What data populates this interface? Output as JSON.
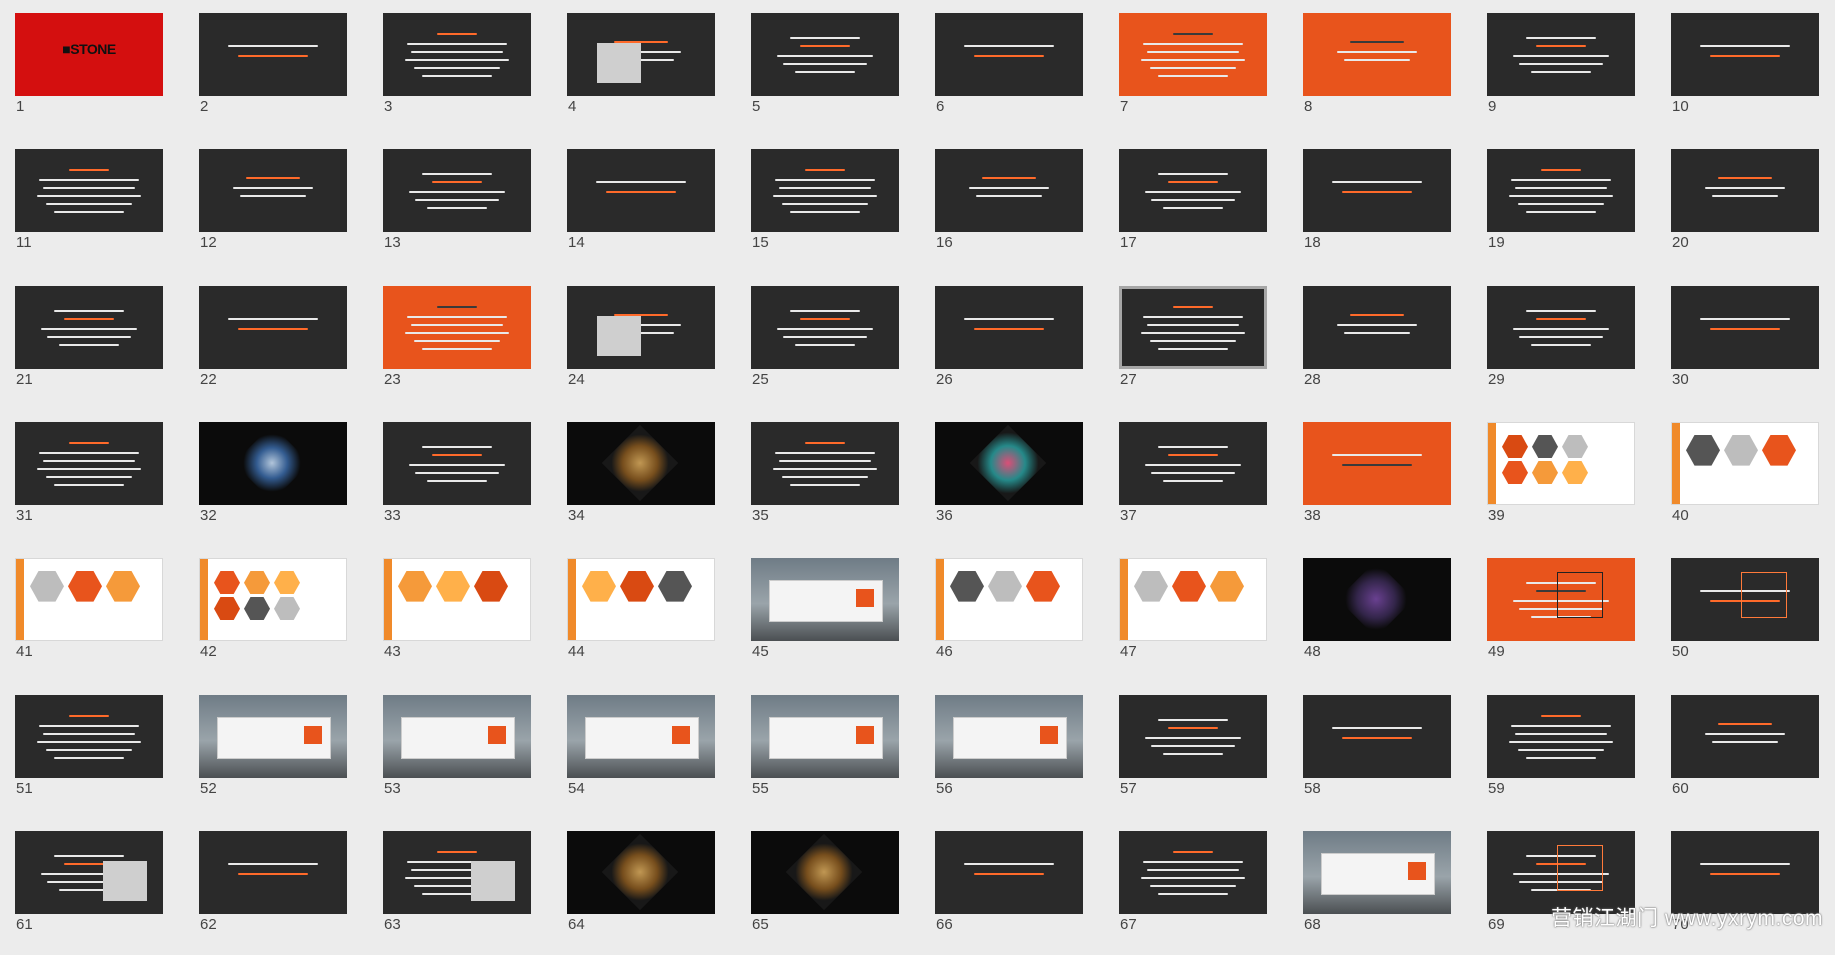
{
  "watermark": "营销江湖门 www.yxrym.com",
  "slide1_logo": "■STONE",
  "selected_slide": 27,
  "slides": [
    {
      "number": "1"
    },
    {
      "number": "2"
    },
    {
      "number": "3"
    },
    {
      "number": "4"
    },
    {
      "number": "5"
    },
    {
      "number": "6"
    },
    {
      "number": "7"
    },
    {
      "number": "8"
    },
    {
      "number": "9"
    },
    {
      "number": "10"
    },
    {
      "number": "11"
    },
    {
      "number": "12"
    },
    {
      "number": "13"
    },
    {
      "number": "14"
    },
    {
      "number": "15"
    },
    {
      "number": "16"
    },
    {
      "number": "17"
    },
    {
      "number": "18"
    },
    {
      "number": "19"
    },
    {
      "number": "20"
    },
    {
      "number": "21"
    },
    {
      "number": "22"
    },
    {
      "number": "23"
    },
    {
      "number": "24"
    },
    {
      "number": "25"
    },
    {
      "number": "26"
    },
    {
      "number": "27"
    },
    {
      "number": "28"
    },
    {
      "number": "29"
    },
    {
      "number": "30"
    },
    {
      "number": "31"
    },
    {
      "number": "32"
    },
    {
      "number": "33"
    },
    {
      "number": "34"
    },
    {
      "number": "35"
    },
    {
      "number": "36"
    },
    {
      "number": "37"
    },
    {
      "number": "38"
    },
    {
      "number": "39"
    },
    {
      "number": "40"
    },
    {
      "number": "41"
    },
    {
      "number": "42"
    },
    {
      "number": "43"
    },
    {
      "number": "44"
    },
    {
      "number": "45"
    },
    {
      "number": "46"
    },
    {
      "number": "47"
    },
    {
      "number": "48"
    },
    {
      "number": "49"
    },
    {
      "number": "50"
    },
    {
      "number": "51"
    },
    {
      "number": "52"
    },
    {
      "number": "53"
    },
    {
      "number": "54"
    },
    {
      "number": "55"
    },
    {
      "number": "56"
    },
    {
      "number": "57"
    },
    {
      "number": "58"
    },
    {
      "number": "59"
    },
    {
      "number": "60"
    },
    {
      "number": "61"
    },
    {
      "number": "62"
    },
    {
      "number": "63"
    },
    {
      "number": "64"
    },
    {
      "number": "65"
    },
    {
      "number": "66"
    },
    {
      "number": "67"
    },
    {
      "number": "68"
    },
    {
      "number": "69"
    },
    {
      "number": "70"
    }
  ],
  "theme_colors": {
    "dark": "#2a2a2a",
    "orange": "#e8541c",
    "red": "#d40f0f",
    "white": "#ffffff",
    "black": "#0b0b0b"
  },
  "slide_themes": [
    "red",
    "dark",
    "dark",
    "dark",
    "dark",
    "dark",
    "orange",
    "orange",
    "dark",
    "dark",
    "dark",
    "dark",
    "dark",
    "dark",
    "dark",
    "dark",
    "dark",
    "dark",
    "dark",
    "dark",
    "dark",
    "dark",
    "orange",
    "dark",
    "dark",
    "dark",
    "dark",
    "dark",
    "dark",
    "dark",
    "dark",
    "black",
    "dark",
    "black",
    "dark",
    "black",
    "dark",
    "orange",
    "white",
    "white",
    "white",
    "white",
    "white",
    "white",
    "photo",
    "white",
    "white",
    "black",
    "orange",
    "dark",
    "dark",
    "photo",
    "photo",
    "photo",
    "photo",
    "photo",
    "dark",
    "dark",
    "dark",
    "dark",
    "dark",
    "dark",
    "dark",
    "black",
    "black",
    "dark",
    "dark",
    "photo",
    "dark",
    "dark"
  ]
}
